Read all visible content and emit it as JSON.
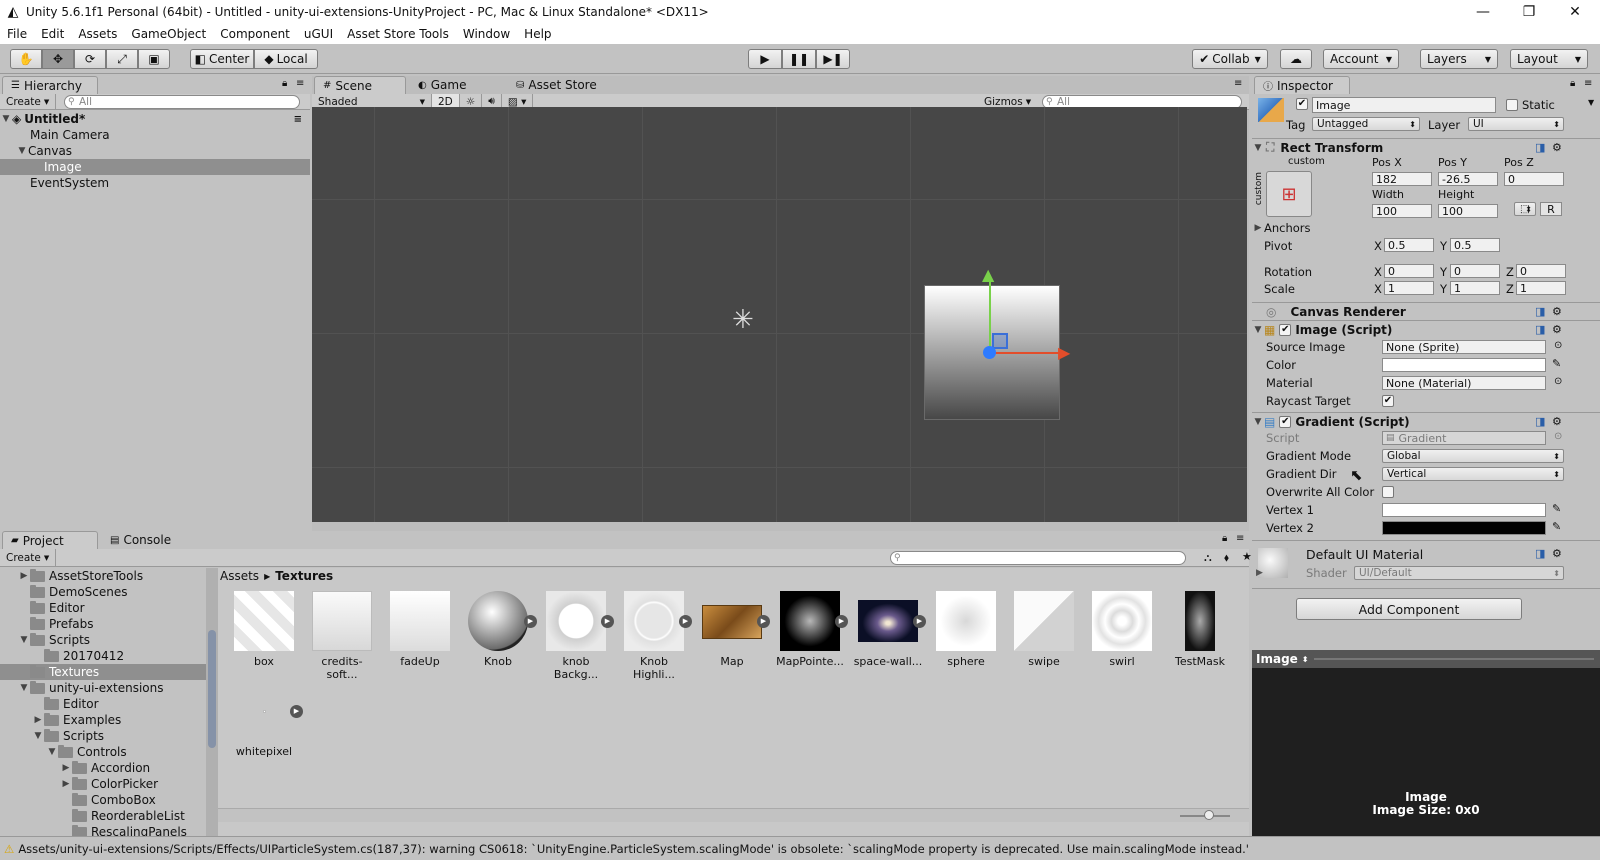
{
  "window": {
    "title": "Unity 5.6.1f1 Personal (64bit) - Untitled - unity-ui-extensions-UnityProject - PC, Mac & Linux Standalone* <DX11>"
  },
  "menu": [
    "File",
    "Edit",
    "Assets",
    "GameObject",
    "Component",
    "uGUI",
    "Asset Store Tools",
    "Window",
    "Help"
  ],
  "toolbar": {
    "center": "Center",
    "local": "Local",
    "collab": "Collab",
    "account": "Account",
    "layers": "Layers",
    "layout": "Layout"
  },
  "hierarchy": {
    "tab": "Hierarchy",
    "create": "Create",
    "search_placeholder": "All",
    "scene_name": "Untitled*",
    "items": [
      {
        "label": "Main Camera"
      },
      {
        "label": "Canvas"
      },
      {
        "label": "Image"
      },
      {
        "label": "EventSystem"
      }
    ]
  },
  "scene": {
    "tabs": [
      "Scene",
      "Game",
      "Asset Store"
    ],
    "shading": "Shaded",
    "mode2d": "2D",
    "gizmos": "Gizmos",
    "search_placeholder": "All"
  },
  "inspector": {
    "tab": "Inspector",
    "object_name": "Image",
    "static_label": "Static",
    "tag_label": "Tag",
    "tag_value": "Untagged",
    "layer_label": "Layer",
    "layer_value": "UI",
    "rect": {
      "title": "Rect Transform",
      "anchor_preset": "custom",
      "anchor_side": "custom",
      "posx_label": "Pos X",
      "posy_label": "Pos Y",
      "posz_label": "Pos Z",
      "posx": "182",
      "posy": "-26.5",
      "posz": "0",
      "width_label": "Width",
      "height_label": "Height",
      "width": "100",
      "height": "100",
      "r_button": "R",
      "anchors_label": "Anchors",
      "pivot_label": "Pivot",
      "pivot_x": "0.5",
      "pivot_y": "0.5",
      "rotation_label": "Rotation",
      "rot_x": "0",
      "rot_y": "0",
      "rot_z": "0",
      "scale_label": "Scale",
      "scale_x": "1",
      "scale_y": "1",
      "scale_z": "1",
      "x": "X",
      "y": "Y",
      "z": "Z"
    },
    "canvas_renderer": {
      "title": "Canvas Renderer"
    },
    "image_script": {
      "title": "Image (Script)",
      "source_label": "Source Image",
      "source_value": "None (Sprite)",
      "color_label": "Color",
      "material_label": "Material",
      "material_value": "None (Material)",
      "raycast_label": "Raycast Target"
    },
    "gradient_script": {
      "title": "Gradient (Script)",
      "script_label": "Script",
      "script_value": "Gradient",
      "mode_label": "Gradient Mode",
      "mode_value": "Global",
      "dir_label": "Gradient Dir",
      "dir_value": "Vertical",
      "overwrite_label": "Overwrite All Color",
      "vertex1_label": "Vertex 1",
      "vertex2_label": "Vertex 2"
    },
    "material": {
      "title": "Default UI Material",
      "shader_label": "Shader",
      "shader_value": "UI/Default"
    },
    "add_component": "Add Component",
    "preview": {
      "title": "Image",
      "name": "Image",
      "size": "Image Size: 0x0"
    }
  },
  "project": {
    "tabs": [
      "Project",
      "Console"
    ],
    "create": "Create",
    "breadcrumb": [
      "Assets",
      "Textures"
    ],
    "tree": [
      {
        "label": "AssetStoreTools"
      },
      {
        "label": "DemoScenes"
      },
      {
        "label": "Editor"
      },
      {
        "label": "Prefabs"
      },
      {
        "label": "Scripts"
      },
      {
        "label": "20170412"
      },
      {
        "label": "Textures"
      },
      {
        "label": "unity-ui-extensions"
      },
      {
        "label": "Editor"
      },
      {
        "label": "Examples"
      },
      {
        "label": "Scripts"
      },
      {
        "label": "Controls"
      },
      {
        "label": "Accordion"
      },
      {
        "label": "ColorPicker"
      },
      {
        "label": "ComboBox"
      },
      {
        "label": "ReorderableList"
      },
      {
        "label": "RescalingPanels"
      }
    ],
    "assets": [
      {
        "label": "box"
      },
      {
        "label": "credits-soft..."
      },
      {
        "label": "fadeUp"
      },
      {
        "label": "Knob"
      },
      {
        "label": "knob Backg..."
      },
      {
        "label": "Knob Highli..."
      },
      {
        "label": "Map"
      },
      {
        "label": "MapPointe..."
      },
      {
        "label": "space-wall..."
      },
      {
        "label": "sphere"
      },
      {
        "label": "swipe"
      },
      {
        "label": "swirl"
      },
      {
        "label": "TestMask"
      },
      {
        "label": "whitepixel"
      }
    ]
  },
  "status": {
    "message": "Assets/unity-ui-extensions/Scripts/Effects/UIParticleSystem.cs(187,37): warning CS0618: `UnityEngine.ParticleSystem.scalingMode' is obsolete: `scalingMode property is deprecated. Use main.scalingMode instead.'"
  }
}
